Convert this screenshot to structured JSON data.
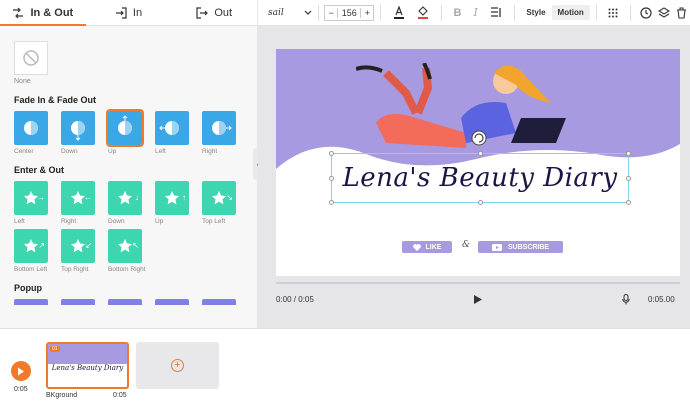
{
  "tabs": [
    {
      "label": "In & Out",
      "icon": "in-out-icon",
      "active": true
    },
    {
      "label": "In",
      "icon": "login-icon",
      "active": false
    },
    {
      "label": "Out",
      "icon": "logout-icon",
      "active": false
    }
  ],
  "none_label": "None",
  "sections": {
    "fade": {
      "title": "Fade In & Fade Out",
      "items": [
        {
          "label": "Center",
          "dir": "center"
        },
        {
          "label": "Down",
          "dir": "down"
        },
        {
          "label": "Up",
          "dir": "up",
          "selected": true
        },
        {
          "label": "Left",
          "dir": "left"
        },
        {
          "label": "Right",
          "dir": "right"
        }
      ]
    },
    "enter": {
      "title": "Enter & Out",
      "items": [
        {
          "label": "Left",
          "dir": "→"
        },
        {
          "label": "Right",
          "dir": "←"
        },
        {
          "label": "Down",
          "dir": "↓"
        },
        {
          "label": "Up",
          "dir": "↑"
        },
        {
          "label": "Top Left",
          "dir": "↘"
        },
        {
          "label": "Bottom Left",
          "dir": "↗"
        },
        {
          "label": "Top Right",
          "dir": "↙"
        },
        {
          "label": "Bottom Right",
          "dir": "↖"
        }
      ]
    },
    "popup": {
      "title": "Popup"
    }
  },
  "toolbar": {
    "font": "sail",
    "font_size": "156",
    "minus": "−",
    "plus": "+",
    "style_label": "Style",
    "motion_label": "Motion"
  },
  "canvas": {
    "title": "Lena's Beauty Diary",
    "like": "LIKE",
    "amp": "&",
    "subscribe": "SUBSCRIBE"
  },
  "player": {
    "time": "0:00 / 0:05",
    "duration": "0:05.00"
  },
  "timeline": {
    "duration": "0:05",
    "clip_badge": "01",
    "clip_title": "Lena's Beauty Diary",
    "clip_name": "BKground",
    "clip_duration": "0:05"
  },
  "colors": {
    "accent": "#f07a2a",
    "fade_tile": "#3aa7e6",
    "enter_tile": "#3dd6b1",
    "lavender": "#a89ae0"
  }
}
